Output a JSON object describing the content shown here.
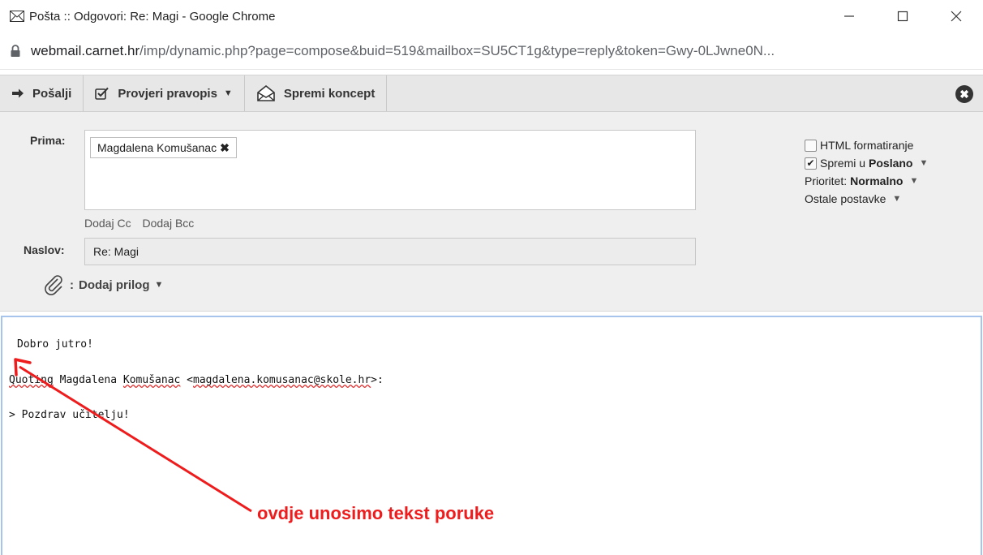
{
  "window": {
    "title": "Pošta :: Odgovori: Re: Magi - Google Chrome",
    "controls": {
      "minimize": "—",
      "maximize": "☐",
      "close": "✕"
    }
  },
  "urlbar": {
    "host": "webmail.carnet.hr",
    "path": "/imp/dynamic.php?page=compose&buid=519&mailbox=SU5CT1g&type=reply&token=Gwy-0LJwne0N..."
  },
  "toolbar": {
    "send_label": "Pošalji",
    "spell_label": "Provjeri pravopis",
    "draft_label": "Spremi koncept",
    "close_glyph": "✖"
  },
  "compose": {
    "to_label": "Prima:",
    "recipient": "Magdalena Komušanac",
    "recipient_remove": "✖",
    "add_cc": "Dodaj Cc",
    "add_bcc": "Dodaj Bcc",
    "subject_label": "Naslov:",
    "subject_value": "Re: Magi",
    "attach_colon": ":",
    "attach_label": "Dodaj prilog"
  },
  "options": {
    "html_label": "HTML formatiranje",
    "html_checked": false,
    "save_prefix": "Spremi u",
    "save_folder": "Poslano",
    "save_checked": true,
    "priority_prefix": "Prioritet:",
    "priority_value": "Normalno",
    "more_label": "Ostale postavke"
  },
  "body": {
    "line1": "Dobro jutro!",
    "quote_prefix": "Quoting",
    "quote_name1": "Magdalena",
    "quote_name2": "Komušanac",
    "quote_email": "magdalena.komusanac@skole.hr",
    "quote_end": ">:",
    "quoted_line": "> Pozdrav učitelju!"
  },
  "annotation": {
    "text": "ovdje unosimo tekst poruke",
    "color": "#ee1c1c"
  }
}
